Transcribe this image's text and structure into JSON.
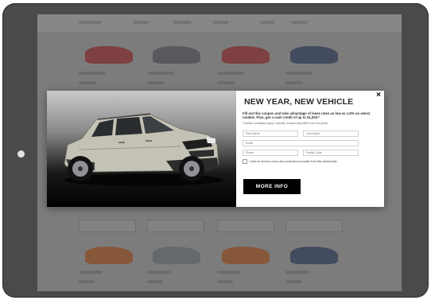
{
  "modal": {
    "title": "NEW YEAR, NEW VEHICLE",
    "body": "Fill out this coupon and take advantage of lease rates as low as 1.9% on select models. Plus, get a cash credit of up to $1,000.*",
    "fine_print": "*Certain conditions apply. Specific models may differ from the photo.",
    "close_label": "×",
    "fields": {
      "first_name": "First Name",
      "last_name": "Last Name",
      "email": "Email",
      "phone": "Phone",
      "postal_code": "Postal Code"
    },
    "checkbox_label": "I wish to receive news and promotions emails from this dealership.",
    "cta_label": "MORE INFO"
  },
  "colors": {
    "device": "#4a4a4a",
    "cta": "#000000",
    "car_body": "#c4c2b4"
  },
  "icons": {
    "close": "close-icon",
    "home": "home-button"
  }
}
